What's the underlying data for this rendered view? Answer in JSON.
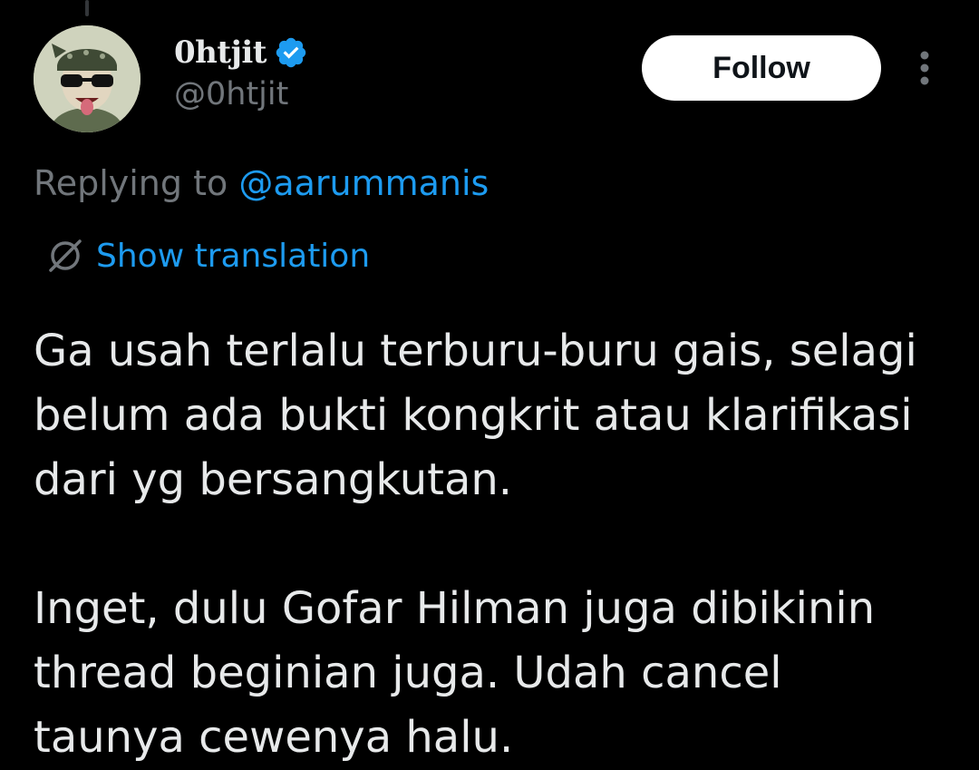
{
  "author": {
    "display_name": "0htjit",
    "handle": "@0htjit",
    "verified": true,
    "avatar_icon": "cartoon-face-with-bandana-and-sunglasses"
  },
  "actions": {
    "follow_label": "Follow",
    "more_icon": "more-vertical-icon"
  },
  "reply_context": {
    "prefix": "Replying to ",
    "handle": "@aarummanis"
  },
  "translation": {
    "label": "Show translation",
    "icon": "globe-icon"
  },
  "tweet": {
    "paragraph_1": [
      "Ga usah terlalu terburu-buru gais, selagi",
      "belum ada bukti kongkrit atau klarifikasi",
      "dari yg bersangkutan."
    ],
    "paragraph_2": [
      "Inget, dulu Gofar Hilman juga dibikinin",
      "thread beginian juga. Udah cancel",
      "taunya cewenya halu."
    ]
  },
  "colors": {
    "background": "#000000",
    "text": "#e7e9ea",
    "secondary_text": "#71767b",
    "link": "#1d9bf0",
    "follow_bg": "#ffffff",
    "verified": "#1d9bf0"
  }
}
